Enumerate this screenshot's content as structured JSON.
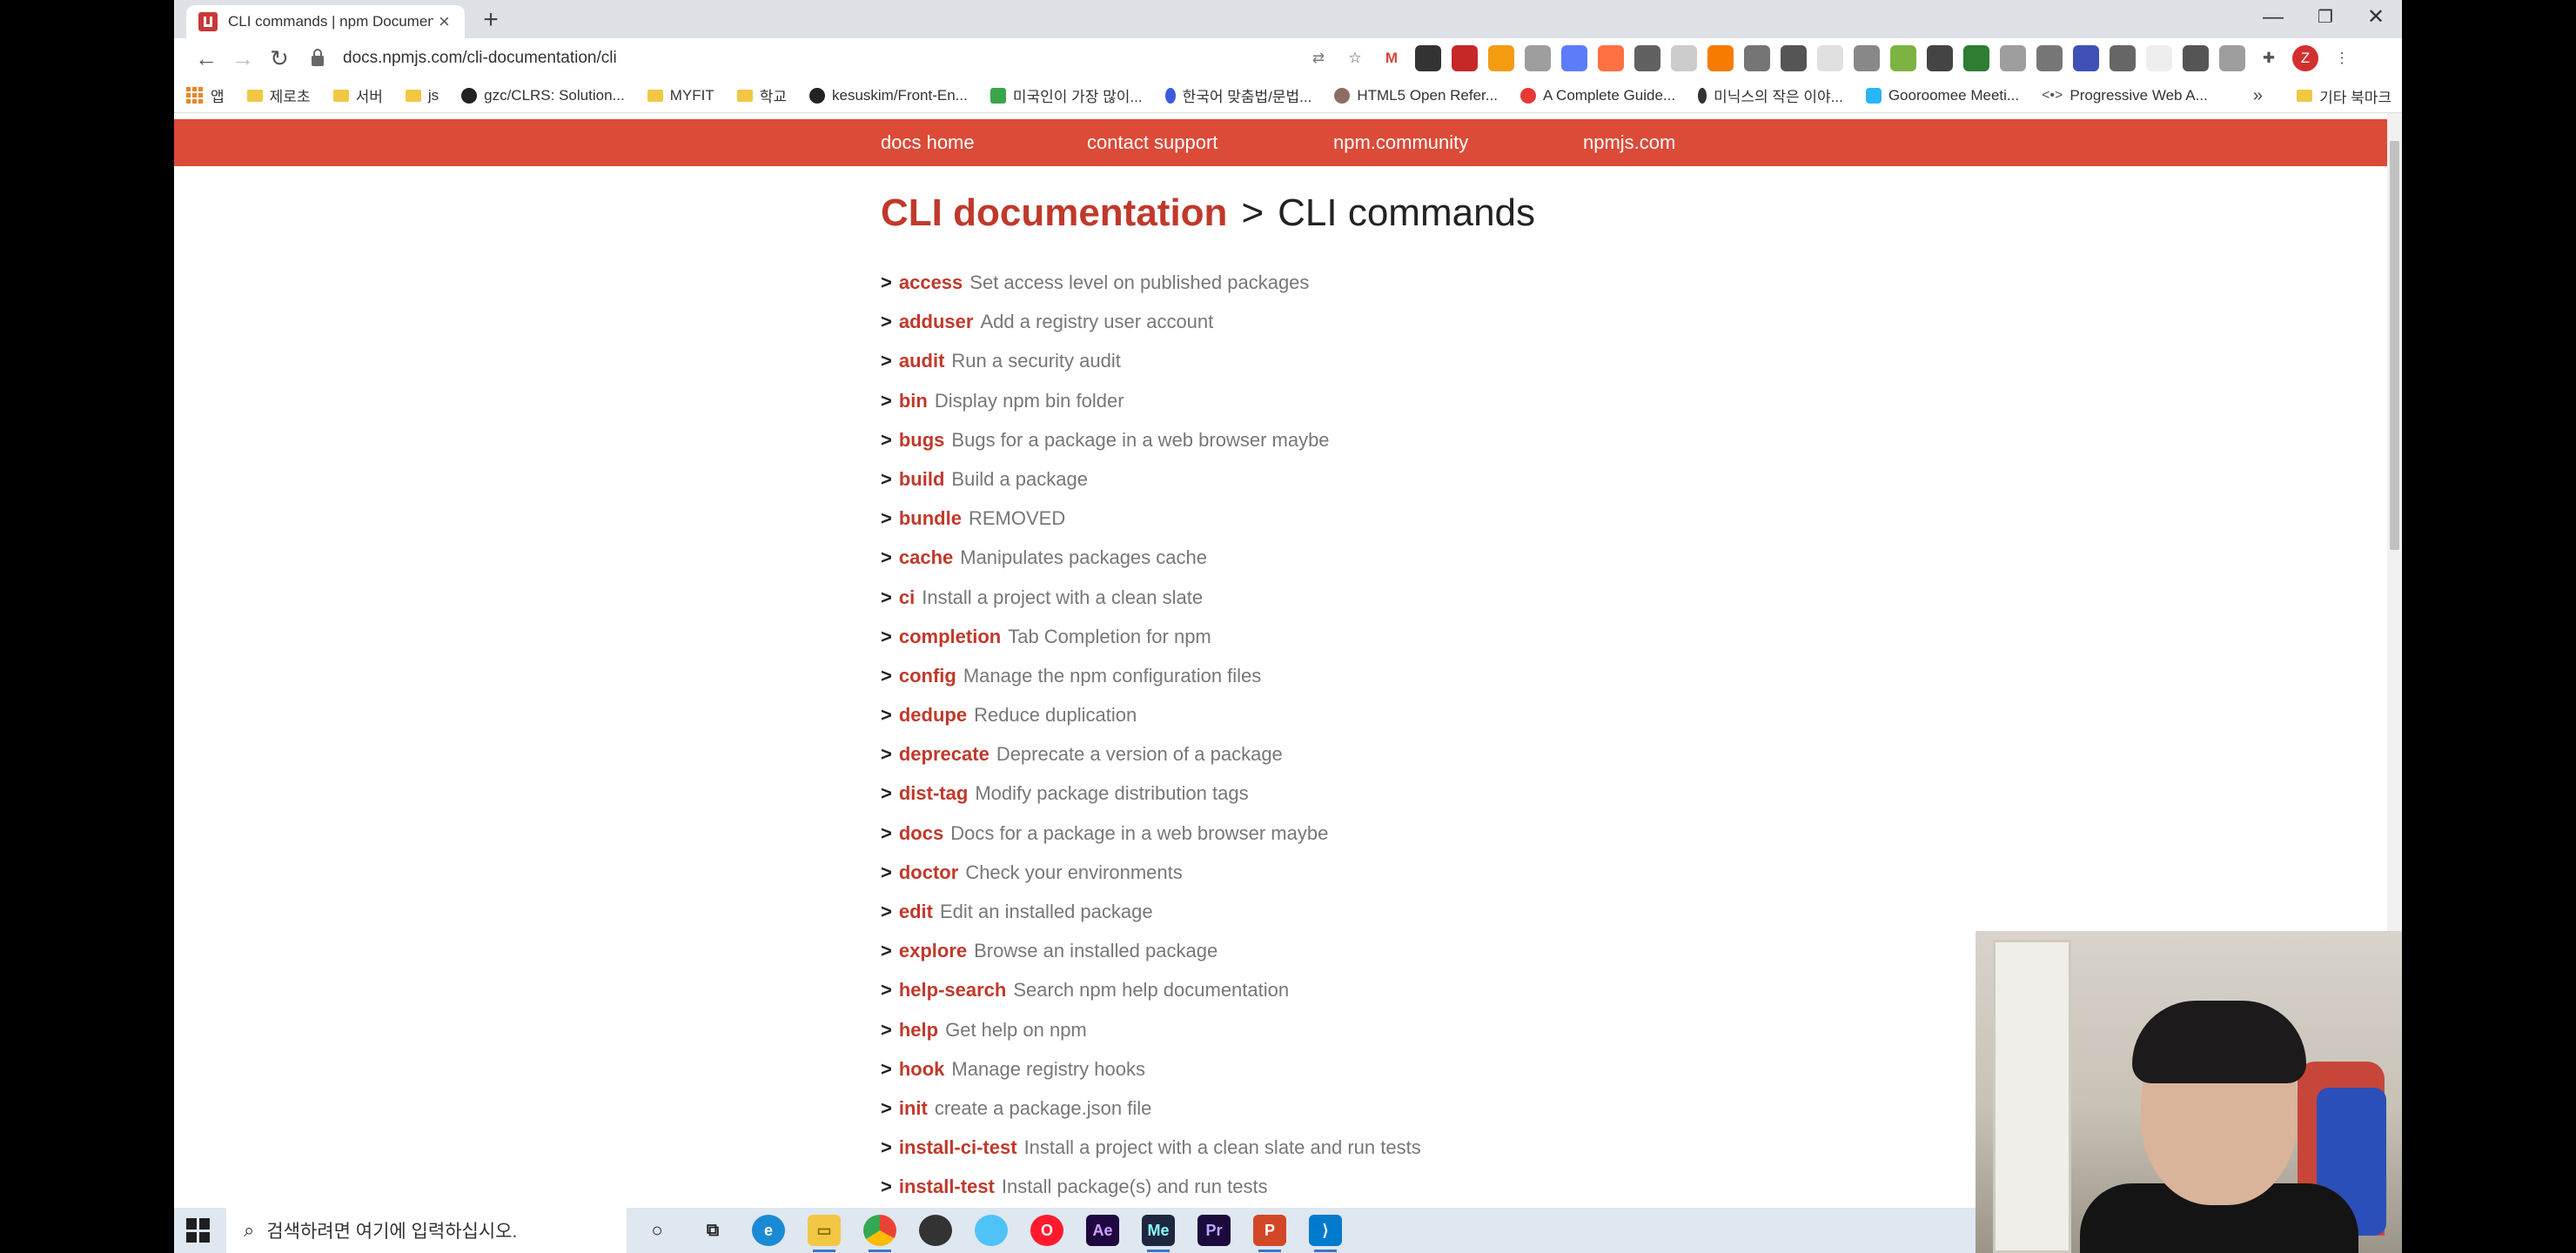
{
  "browser": {
    "tab_title": "CLI commands | npm Documen",
    "tab_close": "×",
    "new_tab": "+",
    "url": "docs.npmjs.com/cli-documentation/cli",
    "window_controls": {
      "minimize": "—",
      "restore": "❐",
      "close": "✕"
    },
    "nav": {
      "back": "←",
      "forward": "→",
      "reload": "↻"
    }
  },
  "bookmarks": [
    {
      "label": "앱",
      "icon": "apps-icon"
    },
    {
      "label": "제로초",
      "icon": "folder-icon"
    },
    {
      "label": "서버",
      "icon": "folder-icon"
    },
    {
      "label": "js",
      "icon": "folder-icon"
    },
    {
      "label": "gzc/CLRS: Solution...",
      "icon": "github-icon"
    },
    {
      "label": "MYFIT",
      "icon": "folder-icon"
    },
    {
      "label": "학교",
      "icon": "folder-icon"
    },
    {
      "label": "kesuskim/Front-En...",
      "icon": "github-icon"
    },
    {
      "label": "미국인이 가장 많이...",
      "icon": "site-icon"
    },
    {
      "label": "한국어 맞춤법/문법...",
      "icon": "site-icon"
    },
    {
      "label": "HTML5 Open Refer...",
      "icon": "site-icon"
    },
    {
      "label": "A Complete Guide...",
      "icon": "site-icon"
    },
    {
      "label": "미닉스의 작은 이야...",
      "icon": "site-icon"
    },
    {
      "label": "Gooroomee Meeti...",
      "icon": "site-icon"
    },
    {
      "label": "Progressive Web A...",
      "icon": "site-icon"
    }
  ],
  "bookmarks_overflow": "»",
  "bookmarks_other": "기타 북마크",
  "site_nav": {
    "docs_home": "docs home",
    "contact_support": "contact support",
    "npm_community": "npm.community",
    "npmjs_com": "npmjs.com"
  },
  "breadcrumb": {
    "parent": "CLI documentation",
    "separator": ">",
    "current": "CLI commands"
  },
  "commands": [
    {
      "name": "access",
      "desc": "Set access level on published packages"
    },
    {
      "name": "adduser",
      "desc": "Add a registry user account"
    },
    {
      "name": "audit",
      "desc": "Run a security audit"
    },
    {
      "name": "bin",
      "desc": "Display npm bin folder"
    },
    {
      "name": "bugs",
      "desc": "Bugs for a package in a web browser maybe"
    },
    {
      "name": "build",
      "desc": "Build a package"
    },
    {
      "name": "bundle",
      "desc": "REMOVED"
    },
    {
      "name": "cache",
      "desc": "Manipulates packages cache"
    },
    {
      "name": "ci",
      "desc": "Install a project with a clean slate"
    },
    {
      "name": "completion",
      "desc": "Tab Completion for npm"
    },
    {
      "name": "config",
      "desc": "Manage the npm configuration files"
    },
    {
      "name": "dedupe",
      "desc": "Reduce duplication"
    },
    {
      "name": "deprecate",
      "desc": "Deprecate a version of a package"
    },
    {
      "name": "dist-tag",
      "desc": "Modify package distribution tags"
    },
    {
      "name": "docs",
      "desc": "Docs for a package in a web browser maybe"
    },
    {
      "name": "doctor",
      "desc": "Check your environments"
    },
    {
      "name": "edit",
      "desc": "Edit an installed package"
    },
    {
      "name": "explore",
      "desc": "Browse an installed package"
    },
    {
      "name": "help-search",
      "desc": "Search npm help documentation"
    },
    {
      "name": "help",
      "desc": "Get help on npm"
    },
    {
      "name": "hook",
      "desc": "Manage registry hooks"
    },
    {
      "name": "init",
      "desc": "create a package.json file"
    },
    {
      "name": "install-ci-test",
      "desc": "Install a project with a clean slate and run tests"
    },
    {
      "name": "install-test",
      "desc": "Install package(s) and run tests"
    }
  ],
  "list_marker": ">",
  "taskbar": {
    "search_placeholder": "검색하려면 여기에 입력하십시오.",
    "apps": [
      "cortana",
      "task-view",
      "edge",
      "file-explorer",
      "chrome",
      "github-desktop",
      "browser",
      "opera",
      "after-effects",
      "media-encoder",
      "premiere-pro",
      "powerpoint",
      "vscode"
    ]
  },
  "colors": {
    "npm_red": "#dc4a38",
    "link_red": "#c0392b",
    "desc_gray": "#777777"
  }
}
